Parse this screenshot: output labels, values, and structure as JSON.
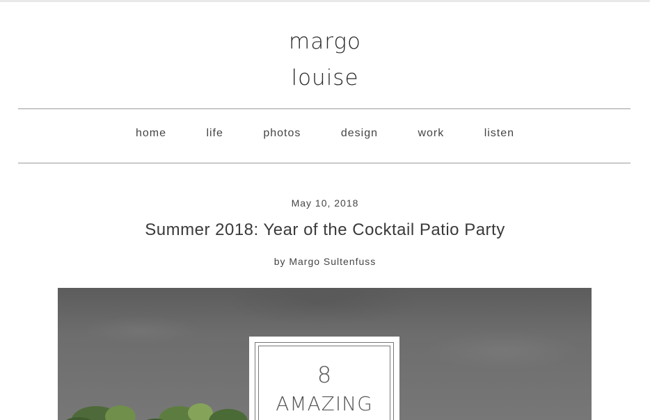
{
  "site": {
    "title_line1": "margo",
    "title_line2": "louise"
  },
  "nav": {
    "items": [
      {
        "label": "home"
      },
      {
        "label": "life"
      },
      {
        "label": "photos"
      },
      {
        "label": "design"
      },
      {
        "label": "work"
      },
      {
        "label": "listen"
      }
    ]
  },
  "post": {
    "date": "May 10, 2018",
    "title": "Summer 2018: Year of the Cocktail Patio Party",
    "author": "by Margo Sultenfuss",
    "hero": {
      "card_number": "8",
      "card_word": "AMAZING"
    }
  }
}
